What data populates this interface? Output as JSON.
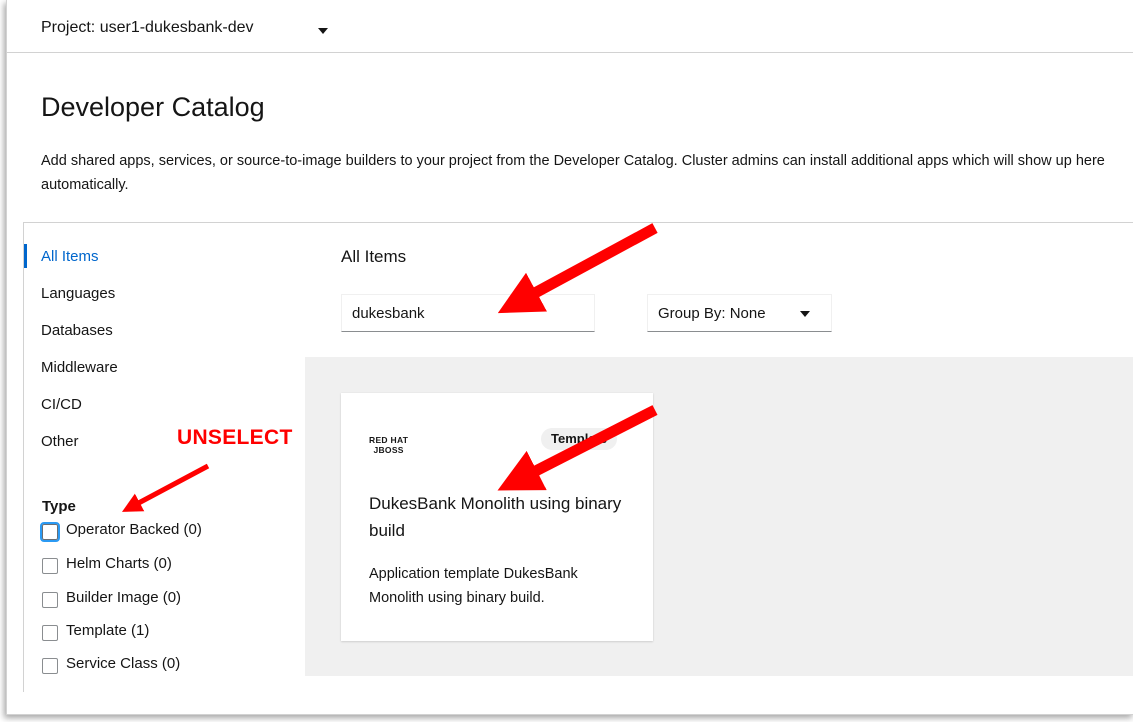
{
  "project": {
    "label": "Project: user1-dukesbank-dev"
  },
  "page": {
    "title": "Developer Catalog",
    "description": "Add shared apps, services, or source-to-image builders to your project from the Developer Catalog. Cluster admins can install additional apps which will show up here automatically."
  },
  "sidebar": {
    "items": [
      {
        "label": "All Items",
        "active": true
      },
      {
        "label": "Languages"
      },
      {
        "label": "Databases"
      },
      {
        "label": "Middleware"
      },
      {
        "label": "CI/CD"
      },
      {
        "label": "Other"
      }
    ],
    "type_title": "Type",
    "types": [
      {
        "label": "Operator Backed (0)",
        "checked": false
      },
      {
        "label": "Helm Charts (0)",
        "checked": false
      },
      {
        "label": "Builder Image (0)",
        "checked": false
      },
      {
        "label": "Template (1)",
        "checked": false
      },
      {
        "label": "Service Class (0)",
        "checked": false
      }
    ]
  },
  "main": {
    "heading": "All Items",
    "search_value": "dukesbank",
    "group_by_label": "Group By: None"
  },
  "tile": {
    "logo_line1": "RED HAT",
    "logo_line2": "JBOSS",
    "badge": "Template",
    "title": "DukesBank Monolith using binary build",
    "description": "Application template DukesBank Monolith using binary build."
  },
  "annotation": {
    "text": "UNSELECT",
    "color": "#ff0000"
  },
  "colors": {
    "accent": "#0066cc",
    "tile_area_bg": "#f0f0f0",
    "annotation": "#ff0000"
  }
}
